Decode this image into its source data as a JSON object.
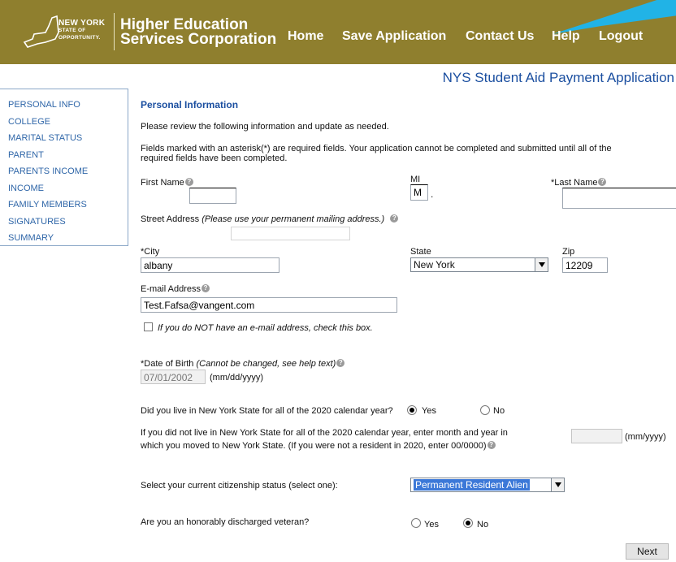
{
  "header": {
    "state_logo": {
      "line1": "NEW YORK",
      "line2": "STATE OF",
      "line3": "OPPORTUNITY."
    },
    "org_line1": "Higher Education",
    "org_line2": "Services Corporation",
    "nav": [
      "Home",
      "Save Application",
      "Contact Us",
      "Help",
      "Logout"
    ],
    "brand_color": "#8f7f2e"
  },
  "app_title": "NYS Student Aid Payment Application",
  "sidebar": {
    "items": [
      "PERSONAL INFO",
      "COLLEGE",
      "MARITAL STATUS",
      "PARENT",
      "PARENTS INCOME",
      "INCOME",
      "FAMILY MEMBERS",
      "SIGNATURES",
      "SUMMARY"
    ]
  },
  "form": {
    "section_title": "Personal Information",
    "intro": "Please review the following information and update as needed.",
    "required_note_1": "Fields marked with an asterisk(*) are required fields. Your application cannot be completed and submitted until all of the",
    "required_note_2": "required fields have been completed.",
    "first_name": {
      "label": "First Name",
      "value": ""
    },
    "mi": {
      "label": "MI",
      "value": "M",
      "suffix": "."
    },
    "last_name": {
      "label": "*Last Name",
      "value": ""
    },
    "street": {
      "label": "Street Address",
      "hint": "(Please use your permanent mailing address.)",
      "value": ""
    },
    "city": {
      "label": "*City",
      "value": "albany"
    },
    "state": {
      "label": "State",
      "value": "New York"
    },
    "zip": {
      "label": "Zip",
      "value": "12209"
    },
    "email": {
      "label": "E-mail Address",
      "value": "Test.Fafsa@vangent.com"
    },
    "no_email": {
      "label": "If you do NOT have an e-mail address, check this box.",
      "checked": false
    },
    "dob": {
      "label": "*Date of Birth",
      "hint": "(Cannot be changed, see help text)",
      "value": "07/01/2002",
      "format": "(mm/dd/yyyy)"
    },
    "ny_resident": {
      "question": "Did you live in New York State for all of the 2020 calendar year?",
      "yes": "Yes",
      "no": "No",
      "selected": "Yes"
    },
    "moved": {
      "line1": "If you did not live in New York State for all of the 2020 calendar year, enter month and year in",
      "line2": "which you moved to New York State. (If you were not a resident in 2020, enter 00/0000)",
      "value": "",
      "format": "(mm/yyyy)"
    },
    "citizenship": {
      "question": "Select your current citizenship status (select one):",
      "value": "Permanent Resident Alien"
    },
    "veteran": {
      "question": "Are you an honorably discharged veteran?",
      "yes": "Yes",
      "no": "No",
      "selected": "No"
    },
    "next": "Next"
  },
  "icons": {
    "help": "question-mark-circle-icon",
    "select_arrow": "chevron-down-icon"
  }
}
